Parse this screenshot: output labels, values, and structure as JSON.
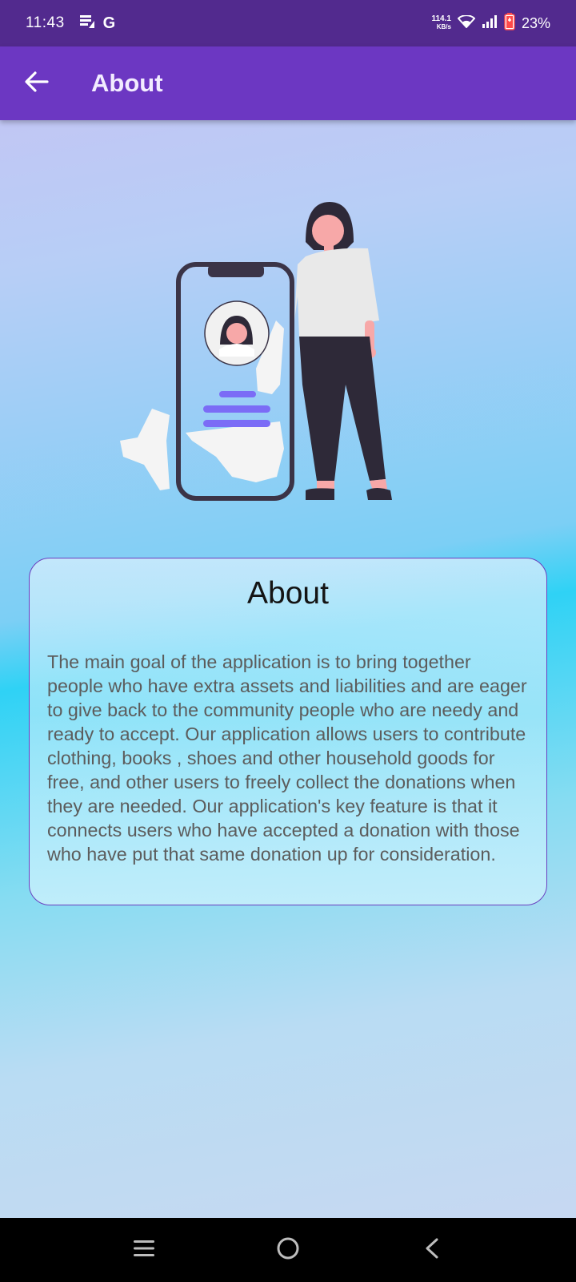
{
  "status_bar": {
    "time": "11:43",
    "carrier_letter": "G",
    "net_speed_value": "114.1",
    "net_speed_unit": "KB/s",
    "battery_percent": "23%"
  },
  "app_bar": {
    "title": "About",
    "back_icon": "arrow-left-icon"
  },
  "illustration": {
    "subject": "woman-standing-next-to-phone-profile-illustration"
  },
  "about_card": {
    "title": "About",
    "body": "The main goal of the application is to bring together people who have extra assets and liabilities and are eager to give back to the community people who are needy and ready to accept. Our application allows users to contribute clothing, books , shoes and other household goods for free, and other users to freely collect the donations when they are needed. Our application's key feature is that it connects users who have accepted a donation with those who have put that same donation up for consideration."
  },
  "nav_bar": {
    "recents_icon": "menu-lines-icon",
    "home_icon": "circle-home-icon",
    "back_icon": "chevron-left-icon"
  },
  "colors": {
    "status_bar": "#522a8e",
    "app_bar": "#6c37c2",
    "card_border": "#6a3fbf",
    "accent_lines": "#7b6cf6"
  }
}
